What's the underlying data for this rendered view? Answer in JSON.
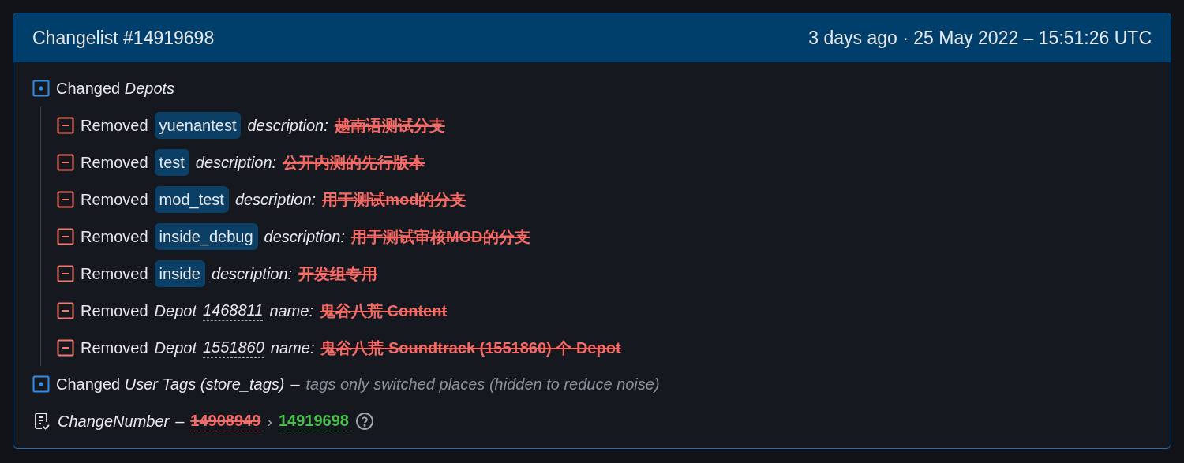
{
  "card": {
    "title": "Changelist #14919698",
    "timestamp": "3 days ago · 25 May 2022 – 15:51:26 UTC"
  },
  "sections": [
    {
      "kind": "changed",
      "verb": "Changed",
      "subject": "Depots",
      "items": [
        {
          "kind": "tag",
          "verb": "Removed",
          "tag": "yuenantest",
          "field": "description:",
          "old_value": "越南语测试分支"
        },
        {
          "kind": "tag",
          "verb": "Removed",
          "tag": "test",
          "field": "description:",
          "old_value": "公开内测的先行版本"
        },
        {
          "kind": "tag",
          "verb": "Removed",
          "tag": "mod_test",
          "field": "description:",
          "old_value": "用于测试mod的分支"
        },
        {
          "kind": "tag",
          "verb": "Removed",
          "tag": "inside_debug",
          "field": "description:",
          "old_value": "用于测试审核MOD的分支"
        },
        {
          "kind": "tag",
          "verb": "Removed",
          "tag": "inside",
          "field": "description:",
          "old_value": "开发组专用"
        },
        {
          "kind": "depot",
          "verb": "Removed",
          "label": "Depot",
          "id": "1468811",
          "field": "name:",
          "old_value": "鬼谷八荒 Content"
        },
        {
          "kind": "depot",
          "verb": "Removed",
          "label": "Depot",
          "id": "1551860",
          "field": "name:",
          "old_value": "鬼谷八荒 Soundtrack (1551860) 个 Depot"
        }
      ]
    },
    {
      "kind": "changed",
      "verb": "Changed",
      "subject": "User Tags (store_tags)",
      "separator": "–",
      "note": "tags only switched places (hidden to reduce noise)"
    }
  ],
  "change_number": {
    "label": "ChangeNumber",
    "separator": "–",
    "old": "14908949",
    "arrow": "›",
    "new": "14919698"
  }
}
